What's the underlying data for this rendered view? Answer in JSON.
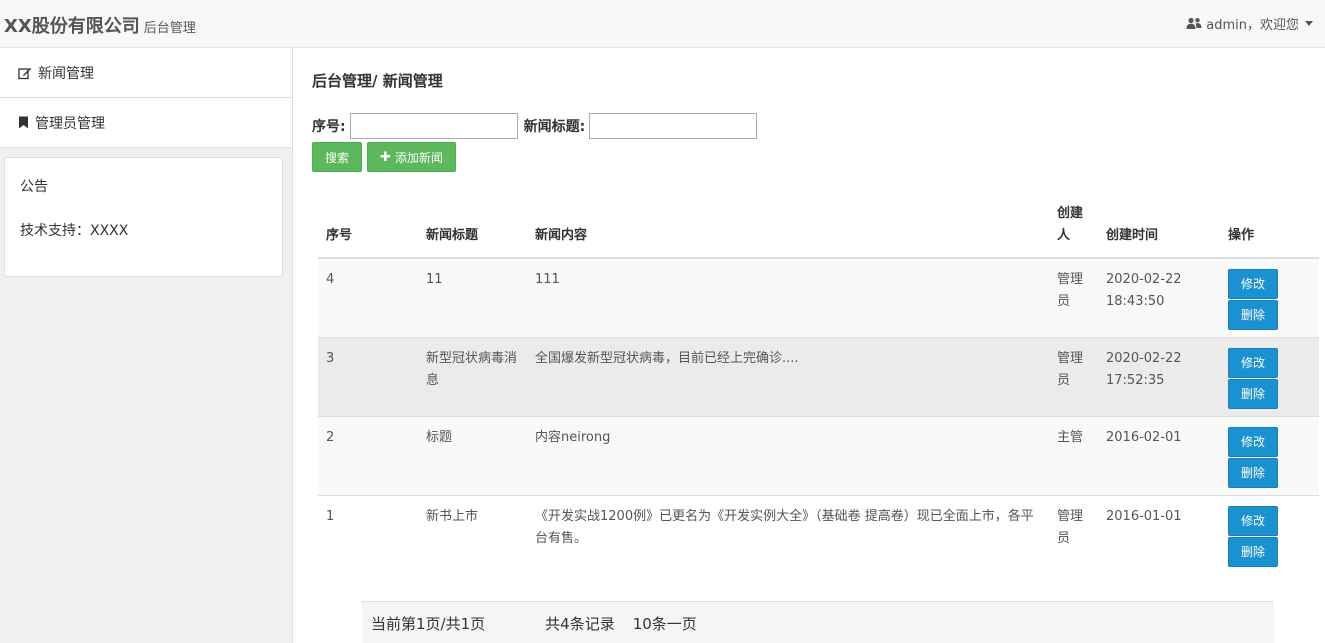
{
  "navbar": {
    "brand": "XX股份有限公司",
    "brand_sub": "后台管理",
    "user_text": "admin，欢迎您"
  },
  "sidebar": {
    "items": [
      {
        "label": "新闻管理",
        "icon": "edit-icon"
      },
      {
        "label": "管理员管理",
        "icon": "bookmark-icon"
      }
    ],
    "panel": {
      "title": "公告",
      "support": "技术支持：XXXX"
    }
  },
  "main": {
    "page_title": "后台管理/ 新闻管理",
    "search": {
      "id_label": "序号:",
      "id_value": "",
      "title_label": "新闻标题:",
      "title_value": ""
    },
    "buttons": {
      "search": "搜索",
      "add": "添加新闻"
    },
    "table": {
      "headers": [
        "序号",
        "新闻标题",
        "新闻内容",
        "创建人",
        "创建时间",
        "操作"
      ],
      "rows": [
        {
          "id": "4",
          "title": "11",
          "content": "111",
          "creator": "管理员",
          "time": "2020-02-22 18:43:50"
        },
        {
          "id": "3",
          "title": "新型冠状病毒消息",
          "content": "全国爆发新型冠状病毒，目前已经上完确诊....",
          "creator": "管理员",
          "time": "2020-02-22 17:52:35"
        },
        {
          "id": "2",
          "title": "标题",
          "content": "内容neirong",
          "creator": "主管",
          "time": "2016-02-01"
        },
        {
          "id": "1",
          "title": "新书上市",
          "content": "《开发实战1200例》已更名为《开发实例大全》（基础卷 提高卷）现已全面上市，各平台有售。",
          "creator": "管理员",
          "time": "2016-01-01"
        }
      ],
      "edit_label": "修改",
      "delete_label": "删除"
    },
    "pager": {
      "current": "当前第1页/共1页",
      "total": "共4条记录",
      "per_page": "10条一页"
    }
  }
}
